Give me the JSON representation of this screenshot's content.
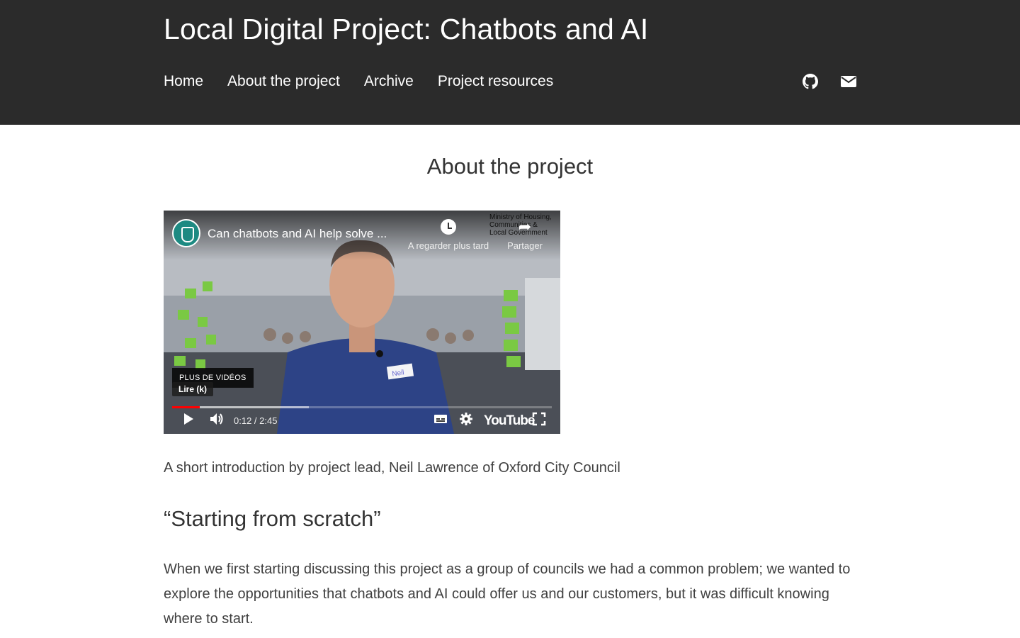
{
  "header": {
    "site_title": "Local Digital Project: Chatbots and AI",
    "nav": [
      {
        "label": "Home"
      },
      {
        "label": "About the project"
      },
      {
        "label": "Archive"
      },
      {
        "label": "Project resources"
      }
    ],
    "icons": [
      "github-icon",
      "envelope-icon"
    ],
    "background_color": "#2b2b2b"
  },
  "main": {
    "page_title": "About the project",
    "video": {
      "title": "Can chatbots and AI help solve ...",
      "watch_later_label": "A regarder plus tard",
      "share_label": "Partager",
      "publisher_logo_text": "Ministry of Housing, Communities & Local Government",
      "more_videos_label": "PLUS DE VIDÉOS",
      "tooltip": "Lire (k)",
      "time_display": "0:12 / 2:45",
      "played_fraction": 0.073,
      "loaded_fraction": 0.36,
      "logo_text": "YouTube",
      "badge_text": "Neil"
    },
    "caption": "A short introduction by project lead, Neil Lawrence of Oxford City Council",
    "section_title": "“Starting from scratch”",
    "paragraph": "When we first starting discussing this project as a group of councils we had a common problem; we wanted to explore the opportunities that chatbots and AI could offer us and our customers, but it was difficult knowing where to start."
  }
}
